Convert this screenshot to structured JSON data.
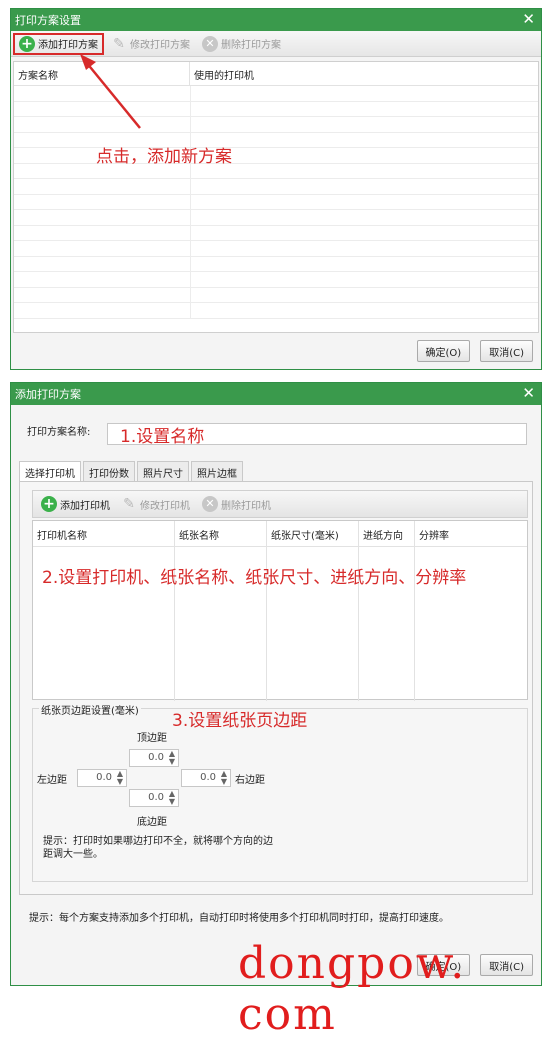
{
  "window1": {
    "title": "打印方案设置",
    "toolbar": {
      "add": "添加打印方案",
      "edit": "修改打印方案",
      "delete": "删除打印方案"
    },
    "columns": [
      "方案名称",
      "使用的打印机"
    ],
    "buttons": {
      "ok": "确定(O)",
      "cancel": "取消(C)"
    }
  },
  "annotations": {
    "a1": "点击，添加新方案",
    "a2": "1.设置名称",
    "a3": "2.设置打印机、纸张名称、纸张尺寸、进纸方向、分辨率",
    "a4": "3.设置纸张页边距"
  },
  "window2": {
    "title": "添加打印方案",
    "name_label": "打印方案名称:",
    "name_value": "",
    "tabs": [
      "选择打印机",
      "打印份数",
      "照片尺寸",
      "照片边框"
    ],
    "toolbar": {
      "add": "添加打印机",
      "edit": "修改打印机",
      "delete": "删除打印机"
    },
    "columns": [
      "打印机名称",
      "纸张名称",
      "纸张尺寸(毫米)",
      "进纸方向",
      "分辨率"
    ],
    "margins": {
      "title": "纸张页边距设置(毫米)",
      "top_label": "顶边距",
      "left_label": "左边距",
      "right_label": "右边距",
      "bottom_label": "底边距",
      "top": "0.0",
      "left": "0.0",
      "right": "0.0",
      "bottom": "0.0",
      "hint": "提示：打印时如果哪边打印不全，就将哪个方向的边距调大一些。"
    },
    "hint": "提示：每个方案支持添加多个打印机，自动打印时将使用多个打印机同时打印，提高打印速度。",
    "buttons": {
      "ok": "确定(O)",
      "cancel": "取消(C)"
    }
  },
  "watermark": "dongpow. com",
  "colors": {
    "title_green": "#3a9a4c",
    "annotation_red": "#d72a2a"
  }
}
